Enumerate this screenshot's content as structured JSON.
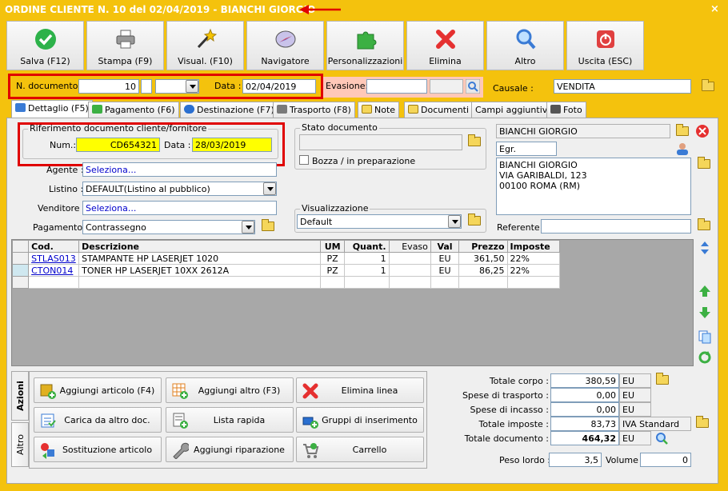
{
  "window": {
    "title": "ORDINE CLIENTE N. 10 del 02/04/2019 - BIANCHI GIORGIO",
    "close": "×"
  },
  "toolbar": [
    {
      "label": "Salva (F12)",
      "icon": "check-icon",
      "color": "#2db24a"
    },
    {
      "label": "Stampa (F9)",
      "icon": "printer-icon",
      "color": "#888888"
    },
    {
      "label": "Visual. (F10)",
      "icon": "magic-wand-icon",
      "color": "#333333"
    },
    {
      "label": "Navigatore",
      "icon": "compass-icon",
      "color": "#6a5acd"
    },
    {
      "label": "Personalizzazioni",
      "icon": "puzzle-icon",
      "color": "#3cb043"
    },
    {
      "label": "Elimina",
      "icon": "delete-x-icon",
      "color": "#e53030"
    },
    {
      "label": "Altro",
      "icon": "magnifier-icon",
      "color": "#3a7bd5"
    },
    {
      "label": "Uscita (ESC)",
      "icon": "power-icon",
      "color": "#e04040"
    }
  ],
  "header": {
    "ndoc_label": "N. documento :",
    "ndoc_value": "10",
    "data_label": "Data :",
    "data_value": "02/04/2019",
    "evasione_label": "Evasione:",
    "causale_label": "Causale :",
    "causale_value": "VENDITA"
  },
  "tabs": [
    {
      "label": "Dettaglio (F5)",
      "icon": "list-icon",
      "color": "#3a7bd5"
    },
    {
      "label": "Pagamento (F6)",
      "icon": "money-icon",
      "color": "#3cb043"
    },
    {
      "label": "Destinazione (F7)",
      "icon": "globe-icon",
      "color": "#2a6fd0"
    },
    {
      "label": "Trasporto (F8)",
      "icon": "truck-icon",
      "color": "#7a7a7a"
    },
    {
      "label": "Note",
      "icon": "note-icon",
      "color": "#f5d65a"
    },
    {
      "label": "Documenti",
      "icon": "folder-icon",
      "color": "#f5d65a"
    },
    {
      "label": "Campi aggiuntivi",
      "icon": "",
      "color": ""
    },
    {
      "label": "Foto",
      "icon": "camera-icon",
      "color": "#555555"
    }
  ],
  "riferimento": {
    "group_title": "Riferimento documento cliente/fornitore",
    "num_label": "Num.:",
    "num_value": "CD654321",
    "data_label": "Data :",
    "data_value": "28/03/2019"
  },
  "fields": {
    "agente_label": "Agente :",
    "agente_value": "Seleziona...",
    "listino_label": "Listino :",
    "listino_value": "DEFAULT(Listino al pubblico)",
    "venditore_label": "Venditore :",
    "venditore_value": "Seleziona...",
    "pagamento_label": "Pagamento :",
    "pagamento_value": "Contrassegno"
  },
  "stato": {
    "title": "Stato documento",
    "bozza_label": "Bozza / in preparazione"
  },
  "visualizzazione": {
    "title": "Visualizzazione",
    "value": "Default"
  },
  "cliente": {
    "name": "BIANCHI GIORGIO",
    "title": "Egr.",
    "address": [
      "BIANCHI GIORGIO",
      "VIA GARIBALDI, 123",
      "00100 ROMA (RM)"
    ],
    "referente_label": "Referente"
  },
  "grid": {
    "columns": [
      "Cod.",
      "Descrizione",
      "UM",
      "Quant.",
      "Evaso",
      "Val",
      "Prezzo",
      "Imposte"
    ],
    "rows": [
      [
        "STLAS013",
        "STAMPANTE HP LASERJET 1020",
        "PZ",
        "1",
        "",
        "EU",
        "361,50",
        "22%"
      ],
      [
        "CTON014",
        "TONER HP LASERJET 10XX 2612A",
        "PZ",
        "1",
        "",
        "EU",
        "86,25",
        "22%"
      ]
    ]
  },
  "side_tabs": [
    "Azioni",
    "Altro"
  ],
  "actions": [
    {
      "label": "Aggiungi articolo (F4)",
      "icon": "add-item-icon",
      "color": "#e0b020"
    },
    {
      "label": "Aggiungi altro (F3)",
      "icon": "add-grid-icon",
      "color": "#e08020"
    },
    {
      "label": "Elimina linea",
      "icon": "delete-x-icon",
      "color": "#e53030"
    },
    {
      "label": "Carica da altro doc.",
      "icon": "load-doc-icon",
      "color": "#3a7bd5"
    },
    {
      "label": "Lista rapida",
      "icon": "quick-list-icon",
      "color": "#3cb043"
    },
    {
      "label": "Gruppi di inserimento",
      "icon": "group-insert-icon",
      "color": "#2a6fd0"
    },
    {
      "label": "Sostituzione articolo",
      "icon": "replace-icon",
      "color": "#3cb043"
    },
    {
      "label": "Aggiungi riparazione",
      "icon": "wrench-icon",
      "color": "#888888"
    },
    {
      "label": "Carrello",
      "icon": "cart-icon",
      "color": "#999999"
    }
  ],
  "totals": [
    {
      "label": "Totale corpo :",
      "value": "380,59",
      "cur": "EU"
    },
    {
      "label": "Spese di trasporto :",
      "value": "0,00",
      "cur": "EU"
    },
    {
      "label": "Spese di incasso :",
      "value": "0,00",
      "cur": "EU"
    },
    {
      "label": "Totale imposte :",
      "value": "83,73",
      "cur": "IVA Standard"
    },
    {
      "label": "Totale documento :",
      "value": "464,32",
      "cur": "EU"
    }
  ],
  "peso": {
    "lordo_label": "Peso lordo :",
    "lordo_value": "3,5",
    "volume_label": "Volume :",
    "volume_value": "0"
  }
}
